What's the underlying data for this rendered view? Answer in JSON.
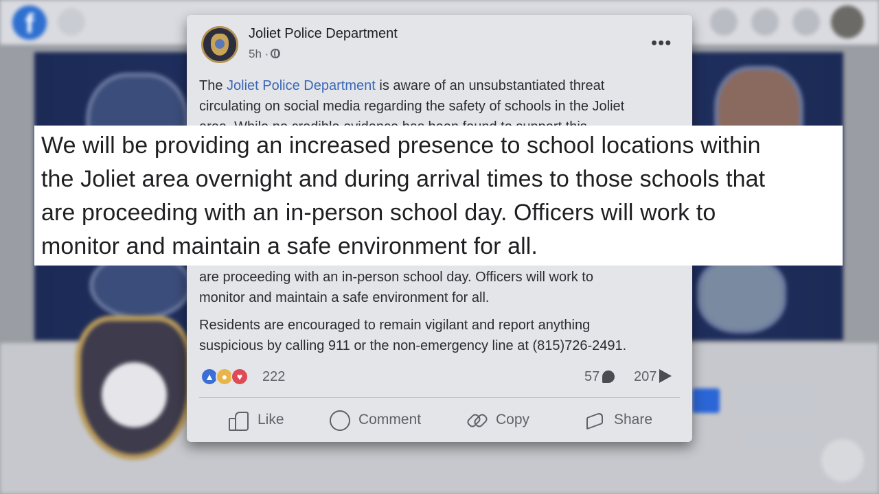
{
  "post": {
    "page_name": "Joliet Police Department",
    "time": "5h ·",
    "paragraph1_prefix": "The ",
    "paragraph1_link": "Joliet Police Department",
    "paragraph1_line1_rest": " is aware of an unsubstantiated threat",
    "paragraph1_line2": "circulating on social media regarding the safety of schools in the Joliet",
    "paragraph1_line3_partial": "area. While no credible evidence has been found to support this",
    "paragraph2_line1": "are proceeding with an in-person school day. Officers will work to",
    "paragraph2_line2": "monitor and maintain a safe environment for all.",
    "paragraph3_line1": "Residents are encouraged to remain vigilant and report anything",
    "paragraph3_line2": "suspicious by calling 911 or the non-emergency line at (815)726-2491.",
    "reaction_count": "222",
    "comment_count": "57",
    "share_count": "207",
    "actions": {
      "like": "Like",
      "comment": "Comment",
      "copy": "Copy",
      "share": "Share"
    }
  },
  "overlay": {
    "line1": "We will be providing an increased presence to school locations within",
    "line2": "the Joliet area overnight and during arrival times to those schools that",
    "line3": "are proceeding with an in-person school day. Officers will work to",
    "line4": "monitor and maintain a safe environment for all."
  },
  "icons": {
    "reactions": [
      "like-reaction-icon",
      "care-reaction-icon",
      "love-reaction-icon"
    ],
    "menu": "more-options-icon",
    "privacy": "globe-icon"
  },
  "colors": {
    "link": "#3a67b7",
    "facebook_blue": "#2e6fd0",
    "overlay_background": "#ffffff"
  }
}
